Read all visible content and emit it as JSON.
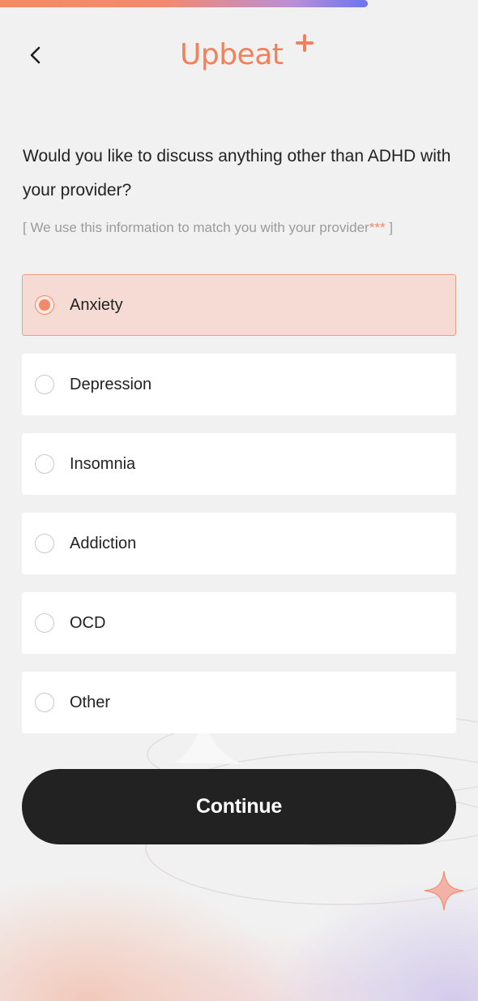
{
  "progress": {
    "fraction": 0.77
  },
  "header": {
    "back_icon": "chevron-left-icon",
    "logo_text": "Upbeat"
  },
  "question": {
    "title": "Would you like to discuss anything other than ADHD with your provider?",
    "hint_open": "[ We use this information to match you with your provider",
    "hint_stars": "***",
    "hint_close": " ]"
  },
  "options": [
    {
      "label": "Anxiety",
      "selected": true
    },
    {
      "label": "Depression",
      "selected": false
    },
    {
      "label": "Insomnia",
      "selected": false
    },
    {
      "label": "Addiction",
      "selected": false
    },
    {
      "label": "OCD",
      "selected": false
    },
    {
      "label": "Other",
      "selected": false
    }
  ],
  "continue_label": "Continue",
  "colors": {
    "brand": "#f2805c",
    "selected_bg": "#f6dbd4",
    "button_bg": "#222222"
  }
}
